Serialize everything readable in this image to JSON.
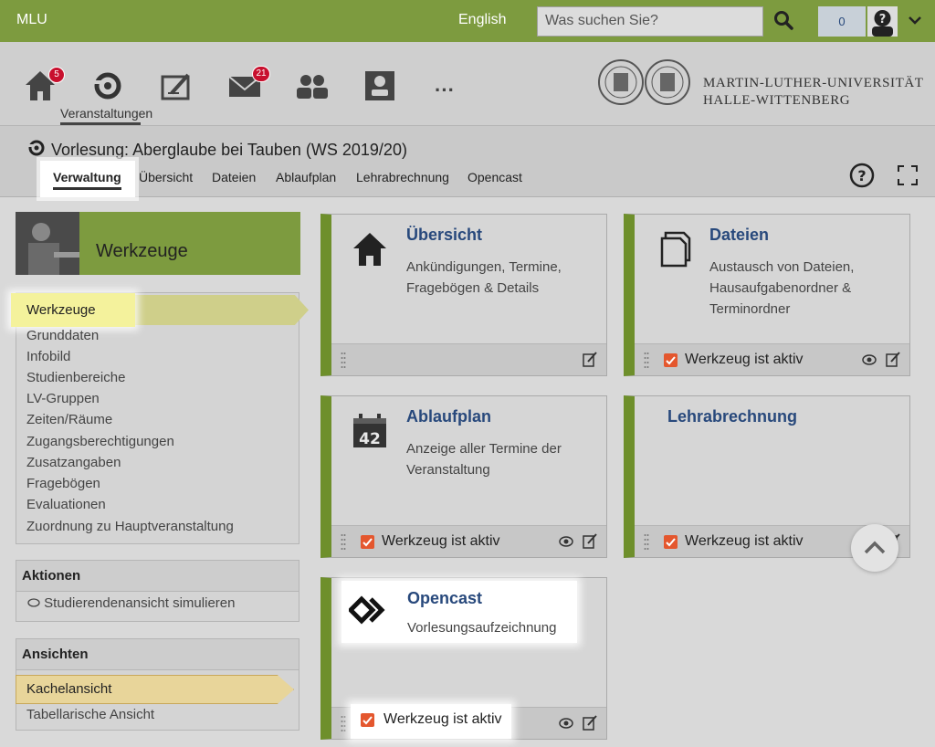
{
  "topbar": {
    "brand": "MLU",
    "language": "English",
    "search_placeholder": "Was suchen Sie?",
    "notification_count": "0"
  },
  "mainnav": {
    "home_badge": "5",
    "messages_badge": "21",
    "active_label": "Veranstaltungen",
    "more": "···",
    "university_line1": "MARTIN-LUTHER-UNIVERSITÄT",
    "university_line2": "HALLE-WITTENBERG"
  },
  "context": {
    "title": "Vorlesung: Aberglaube bei Tauben (WS 2019/20)",
    "tabs": [
      "Verwaltung",
      "Übersicht",
      "Dateien",
      "Ablaufplan",
      "Lehrabrechnung",
      "Opencast"
    ]
  },
  "sidebar": {
    "header": "Werkzeuge",
    "items": [
      "Werkzeuge",
      "Grunddaten",
      "Infobild",
      "Studienbereiche",
      "LV-Gruppen",
      "Zeiten/Räume",
      "Zugangsberechtigungen",
      "Zusatzangaben",
      "Fragebögen",
      "Evaluationen",
      "Zuordnung zu Hauptveranstaltung"
    ],
    "actions_title": "Aktionen",
    "actions": [
      "Studierendenansicht simulieren"
    ],
    "views_title": "Ansichten",
    "views": [
      "Kachelansicht",
      "Tabellarische Ansicht"
    ]
  },
  "tiles": [
    {
      "title": "Übersicht",
      "desc": "Ankündigungen, Termine, Fragebögen & Details",
      "active_label": ""
    },
    {
      "title": "Dateien",
      "desc": "Austausch von Dateien, Hausaufgabenordner & Terminordner",
      "active_label": "Werkzeug ist aktiv"
    },
    {
      "title": "Ablaufplan",
      "desc": "Anzeige aller Termine der Veranstaltung",
      "active_label": "Werkzeug ist aktiv",
      "icon_number": "42"
    },
    {
      "title": "Lehrabrechnung",
      "desc": "",
      "active_label": "Werkzeug ist aktiv"
    },
    {
      "title": "Opencast",
      "desc": "Vorlesungsaufzeichnung",
      "active_label": "Werkzeug ist aktiv"
    }
  ],
  "colors": {
    "brand_green": "#7d9b3f",
    "link_blue": "#28497c",
    "checkbox_orange": "#e4572e",
    "badge_red": "#c8102e"
  }
}
